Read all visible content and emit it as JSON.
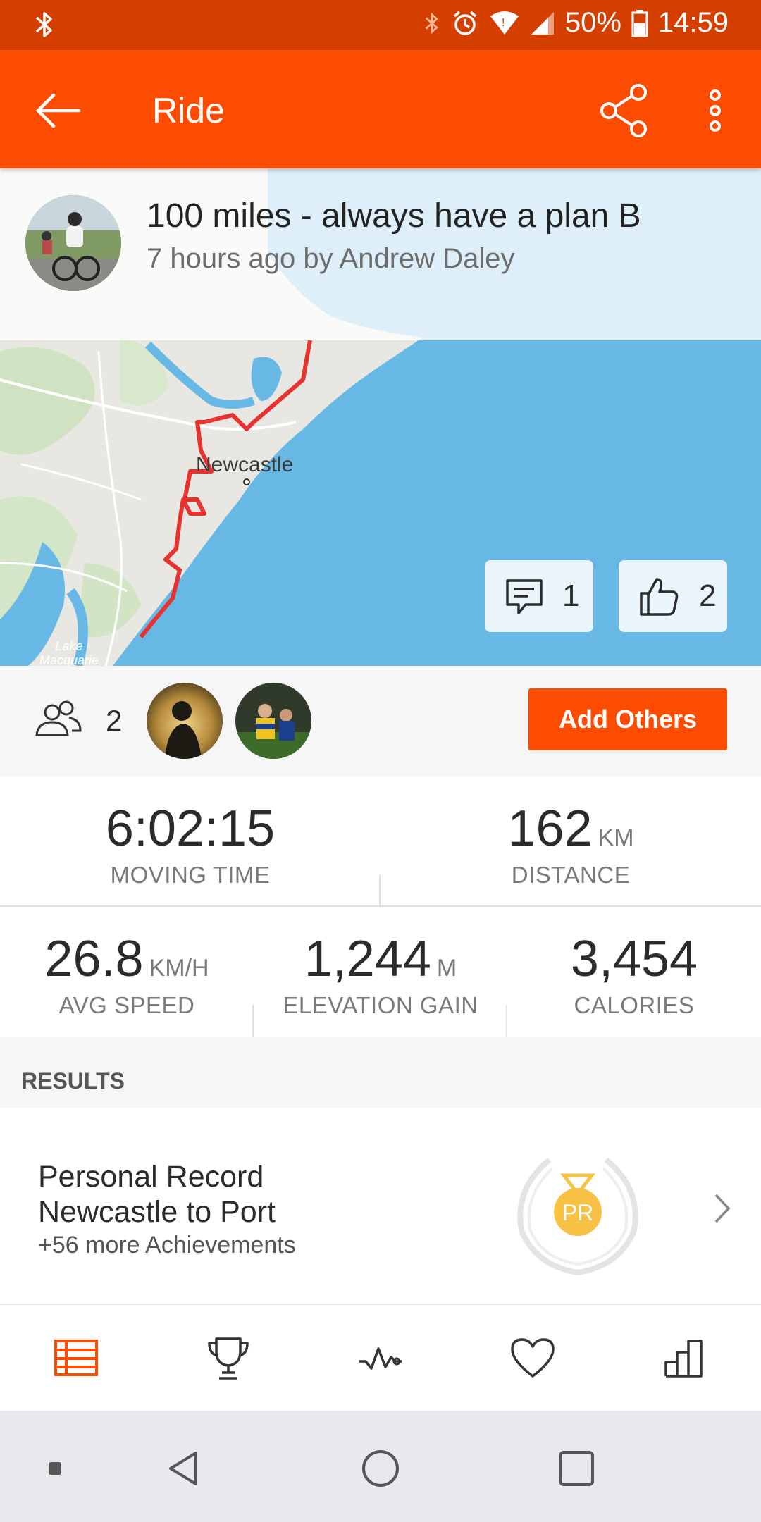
{
  "status_bar": {
    "battery": "50%",
    "time": "14:59"
  },
  "app_bar": {
    "title": "Ride"
  },
  "activity": {
    "title": "100 miles - always have a plan B",
    "subtitle": "7 hours ago by Andrew Daley"
  },
  "map": {
    "city_label": "Newcastle",
    "lake_label_1": "Lake",
    "lake_label_2": "Macquarie",
    "comments_count": "1",
    "kudos_count": "2"
  },
  "group": {
    "count": "2",
    "add_label": "Add Others"
  },
  "stats": {
    "moving_time": {
      "value": "6:02:15",
      "unit": "",
      "label": "MOVING TIME"
    },
    "distance": {
      "value": "162",
      "unit": "KM",
      "label": "DISTANCE"
    },
    "avg_speed": {
      "value": "26.8",
      "unit": "KM/H",
      "label": "AVG SPEED"
    },
    "elevation": {
      "value": "1,244",
      "unit": "M",
      "label": "ELEVATION GAIN"
    },
    "calories": {
      "value": "3,454",
      "unit": "",
      "label": "CALORIES"
    }
  },
  "results": {
    "header": "RESULTS",
    "line1": "Personal Record",
    "line2": "Newcastle to Port",
    "line3": "+56 more Achievements",
    "badge_text": "PR"
  },
  "colors": {
    "brand": "#fc4c02",
    "status_bar": "#d43f00",
    "route": "#e8322f",
    "water": "#68b8e6",
    "medal": "#f7c244"
  }
}
